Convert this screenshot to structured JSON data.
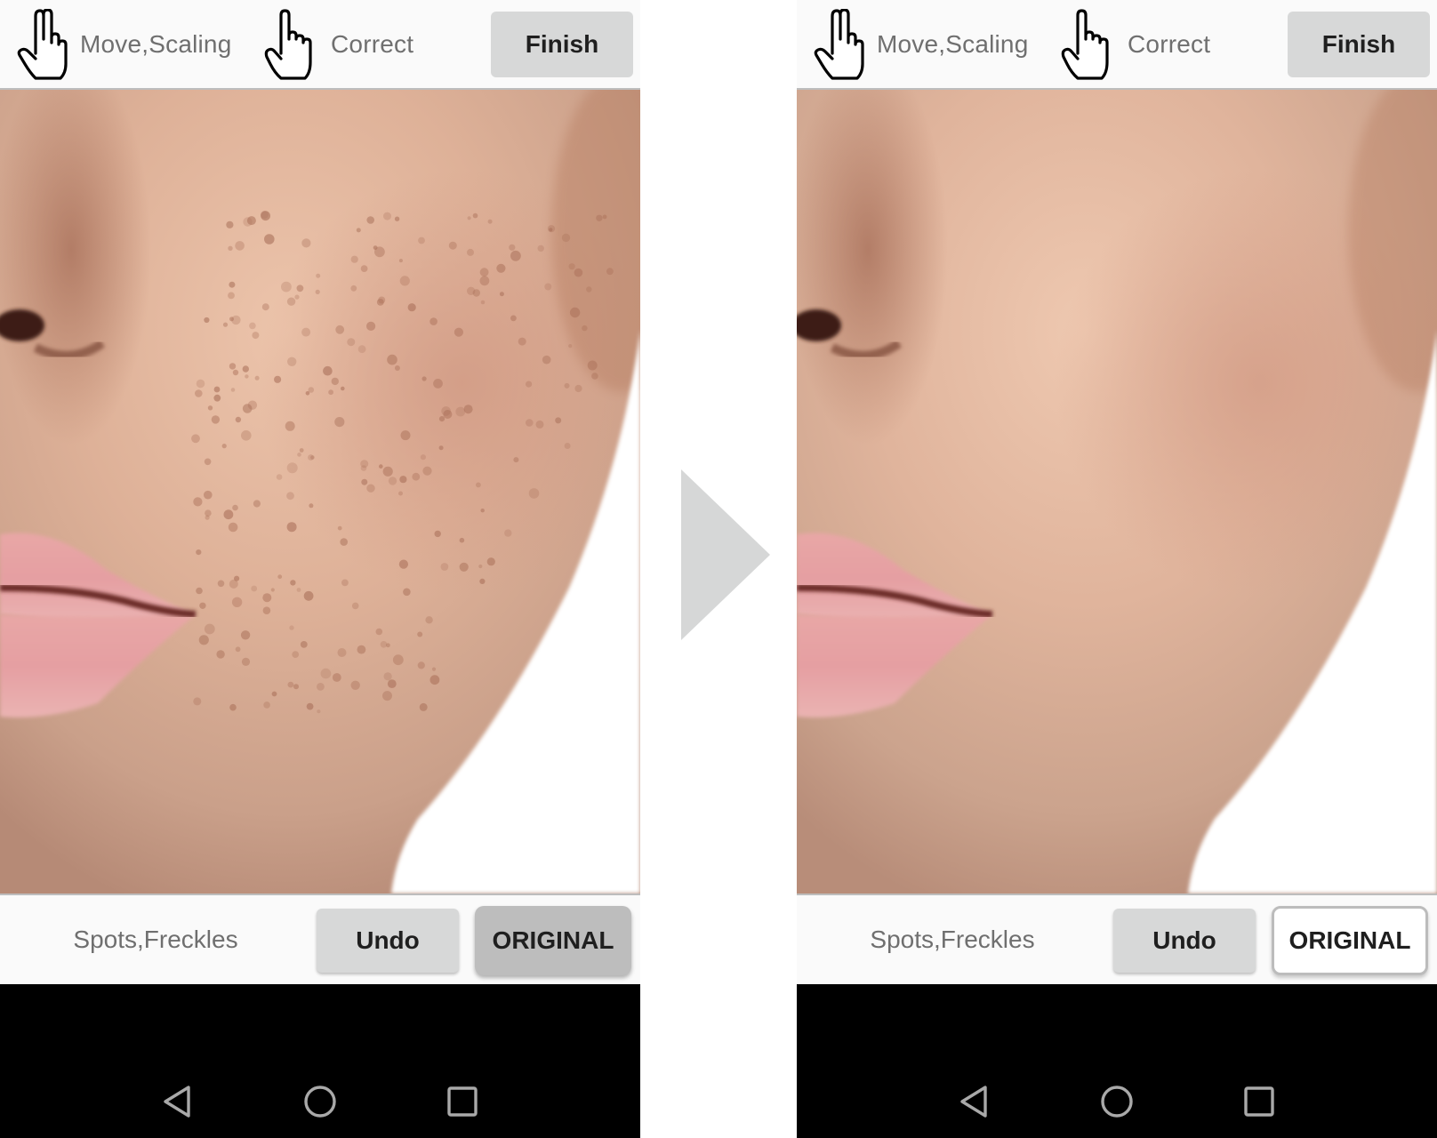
{
  "panels": [
    {
      "id": "before",
      "toolbar": {
        "move_label": "Move,Scaling",
        "correct_label": "Correct",
        "finish_label": "Finish",
        "move_icon": "two-finger-hand-icon",
        "correct_icon": "pointing-hand-icon"
      },
      "bottom": {
        "mode_label": "Spots,Freckles",
        "undo_label": "Undo",
        "original_label": "ORIGINAL",
        "original_state": "pressed"
      },
      "image": {
        "description": "Close-up of cheek with visible spots and freckles",
        "state": "original"
      }
    },
    {
      "id": "after",
      "toolbar": {
        "move_label": "Move,Scaling",
        "correct_label": "Correct",
        "finish_label": "Finish",
        "move_icon": "two-finger-hand-icon",
        "correct_icon": "pointing-hand-icon"
      },
      "bottom": {
        "mode_label": "Spots,Freckles",
        "undo_label": "Undo",
        "original_label": "ORIGINAL",
        "original_state": "released"
      },
      "image": {
        "description": "Same cheek close-up with spots and freckles removed",
        "state": "corrected"
      }
    }
  ],
  "navbar": {
    "back_icon": "back-triangle-icon",
    "home_icon": "home-circle-icon",
    "recent_icon": "recent-apps-square-icon"
  },
  "transition_arrow": "right-arrow-icon",
  "colors": {
    "toolbar_bg": "#fafafa",
    "button_gray": "#d7d8d8",
    "pressed_gray": "#bdbdbd",
    "label_gray": "#6f6f6f",
    "arrow_gray": "#d6d7d7",
    "navbar_bg": "#000000",
    "nav_icon": "#a9a9a9"
  }
}
